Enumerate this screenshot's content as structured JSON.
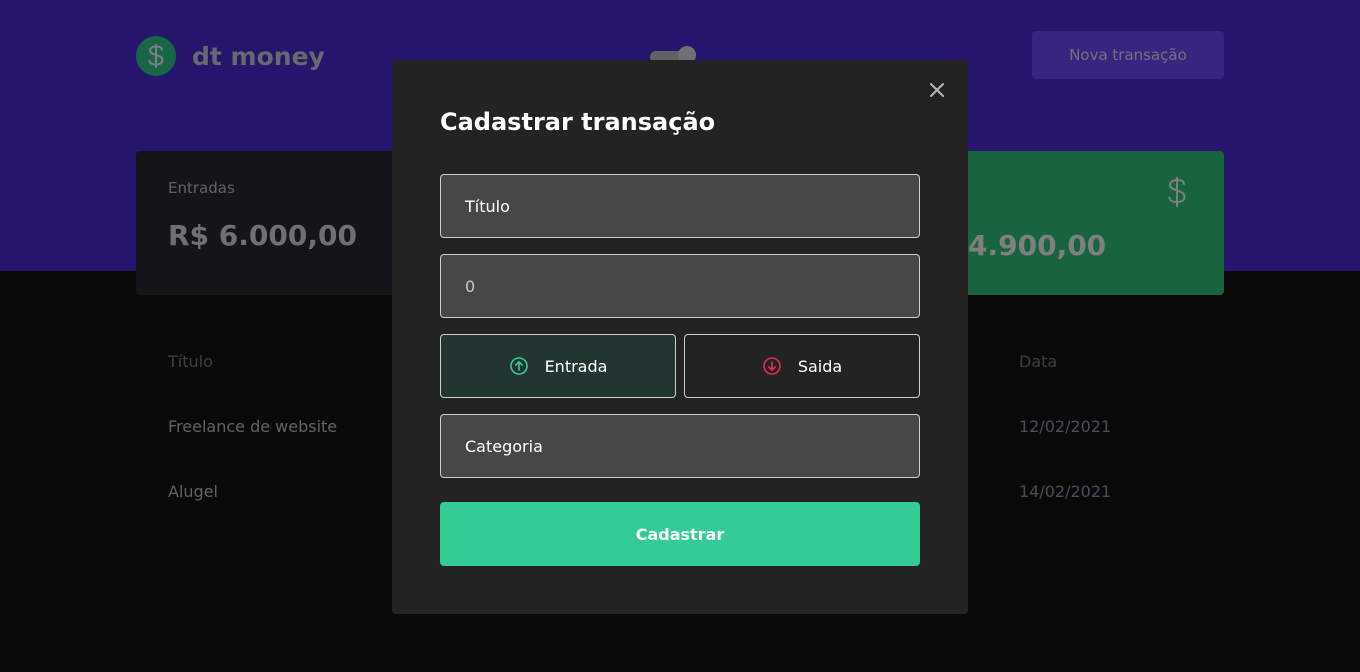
{
  "header": {
    "logo_text": "dt money",
    "new_transaction_label": "Nova transação"
  },
  "summary": {
    "income_label": "Entradas",
    "income_value": "R$ 6.000,00",
    "total_value_partial": "4.900,00"
  },
  "table": {
    "headers": {
      "title": "Título",
      "date": "Data"
    },
    "rows": [
      {
        "title": "Freelance de website",
        "date": "12/02/2021"
      },
      {
        "title": "Alugel",
        "date": "14/02/2021"
      }
    ]
  },
  "modal": {
    "title": "Cadastrar transação",
    "title_field": {
      "placeholder": "Título"
    },
    "amount_field": {
      "value": "0"
    },
    "type_income_label": "Entrada",
    "type_outcome_label": "Saida",
    "category_field": {
      "placeholder": "Categoria"
    },
    "submit_label": "Cadastrar"
  },
  "colors": {
    "brand_purple": "#4a2ad9",
    "green": "#33cc95",
    "red": "#e52e4d",
    "modal_bg": "#232323"
  }
}
